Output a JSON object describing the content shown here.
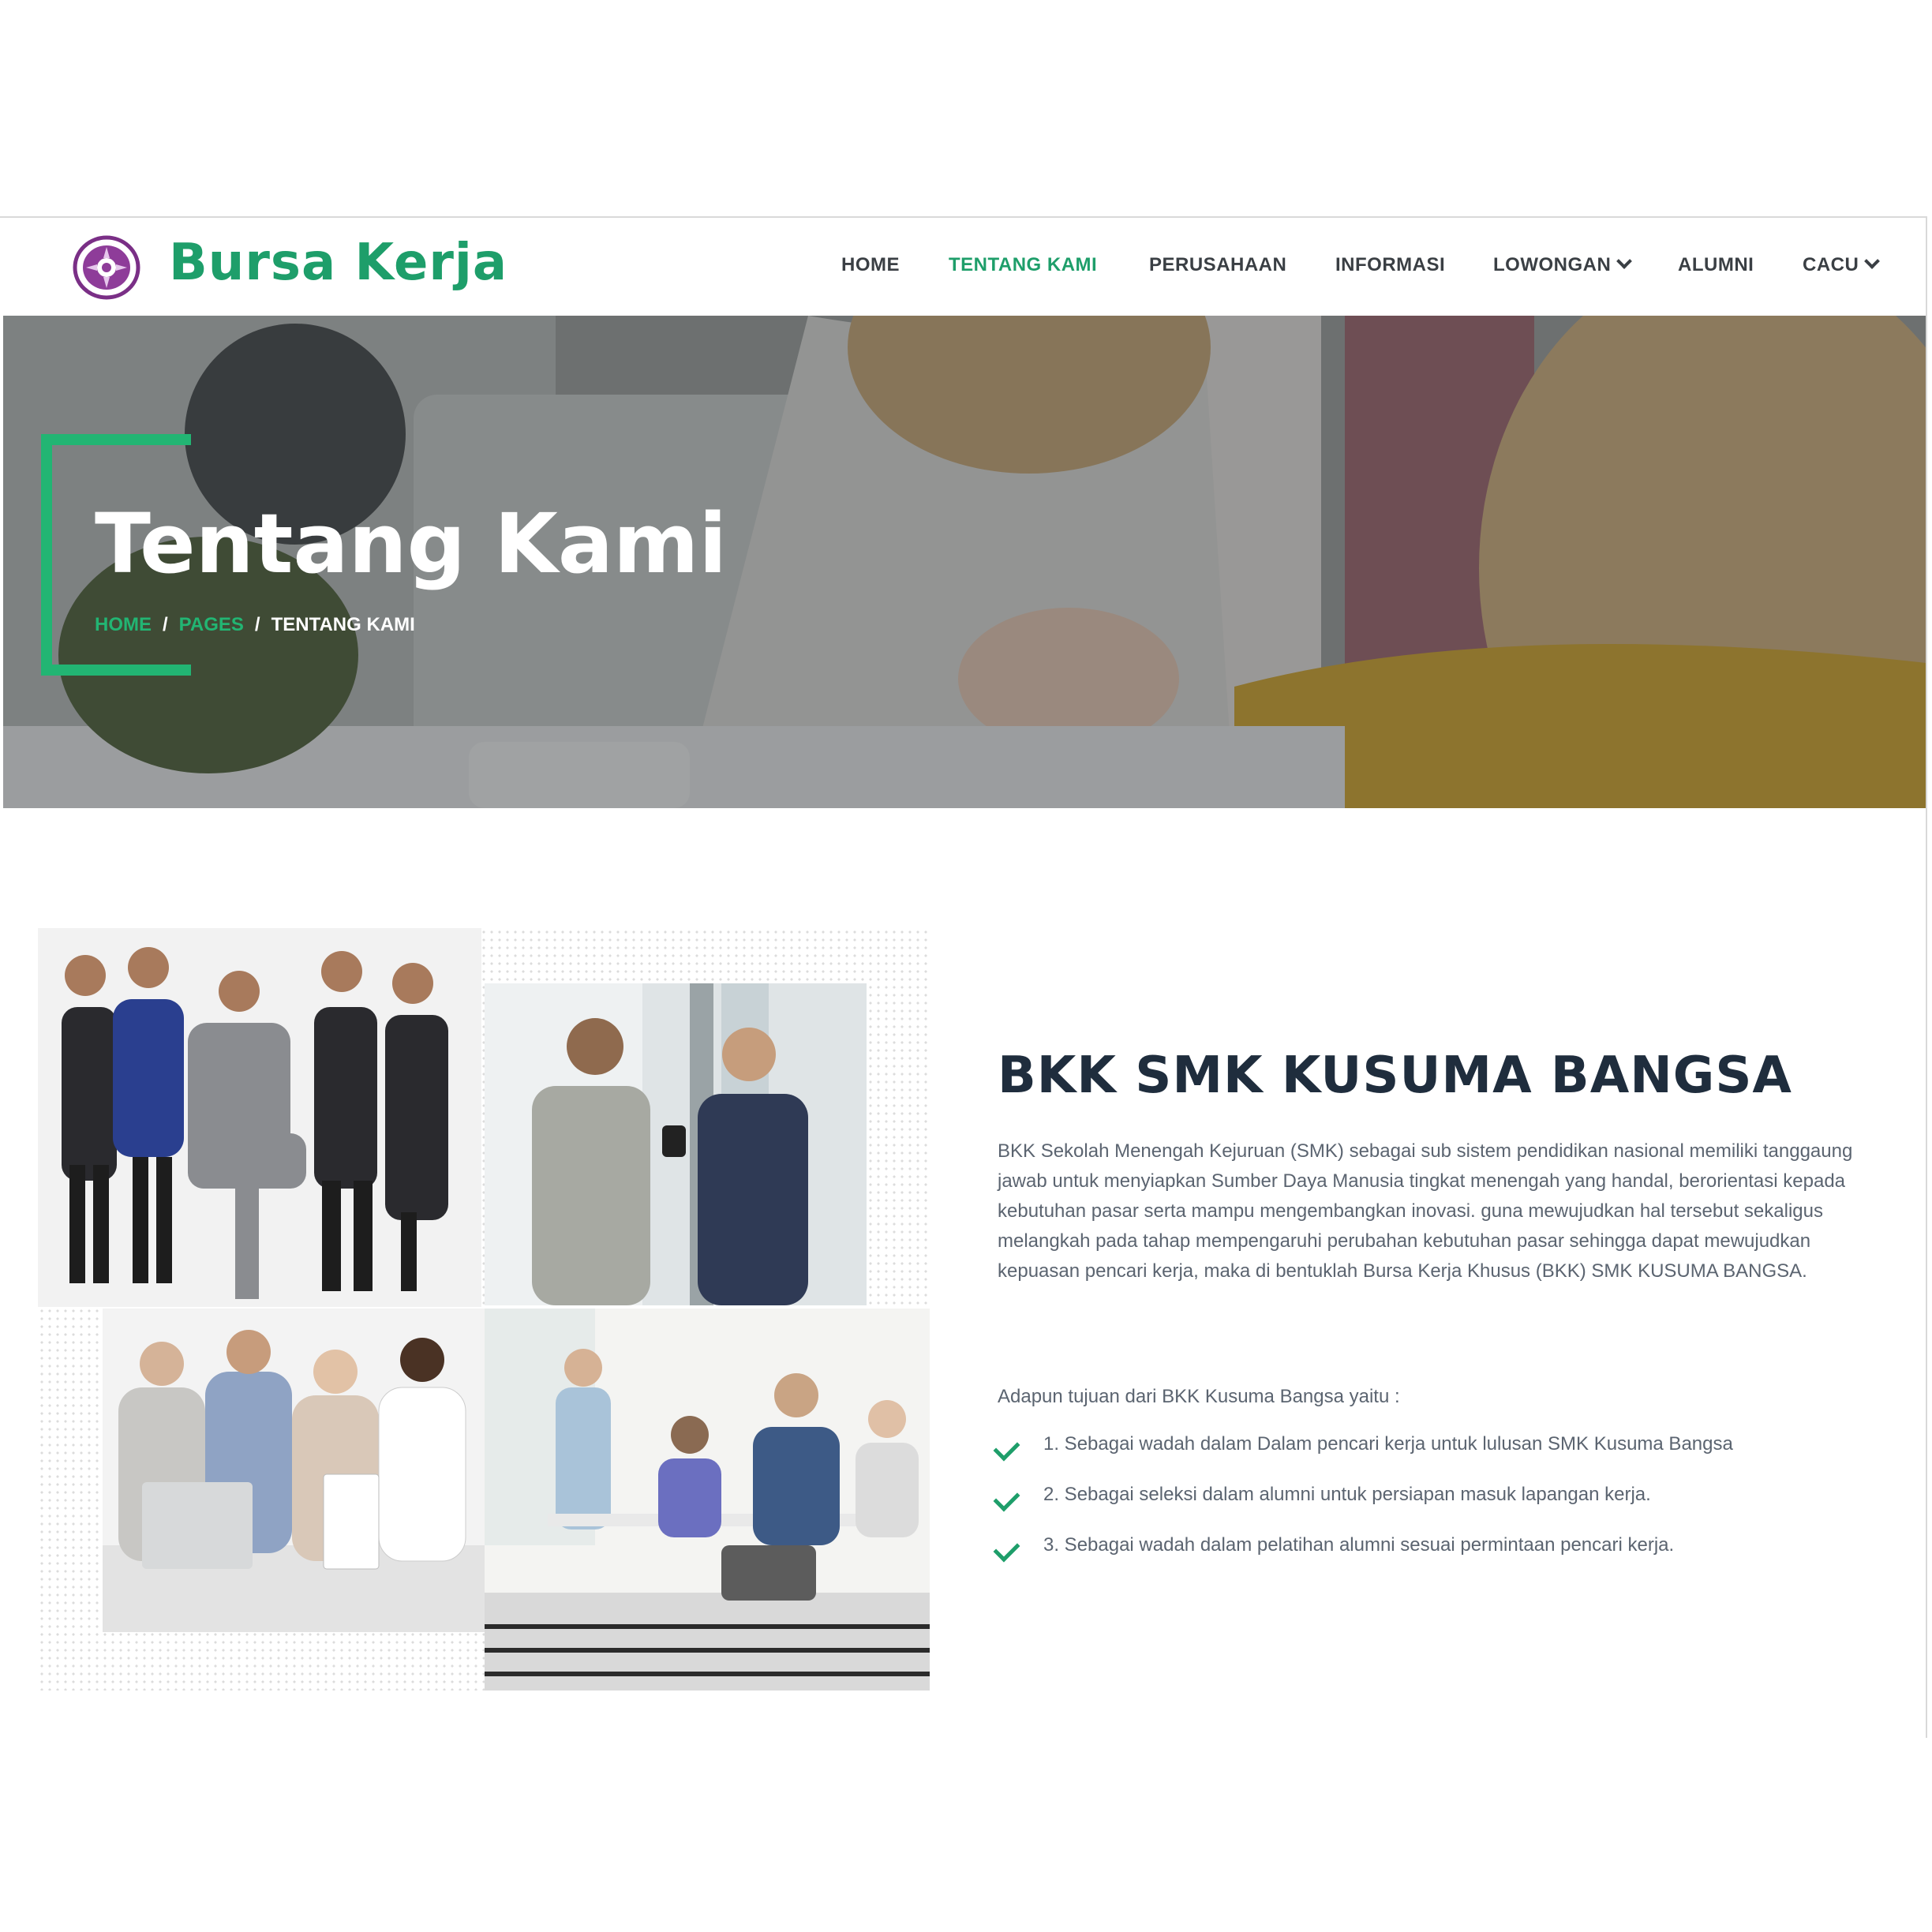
{
  "header": {
    "brand": "Bursa Kerja",
    "logo_icon": "school-emblem-icon",
    "nav": [
      {
        "label": "HOME",
        "active": false,
        "dropdown": false
      },
      {
        "label": "TENTANG KAMI",
        "active": true,
        "dropdown": false
      },
      {
        "label": "PERUSAHAAN",
        "active": false,
        "dropdown": false
      },
      {
        "label": "INFORMASI",
        "active": false,
        "dropdown": false
      },
      {
        "label": "LOWONGAN",
        "active": false,
        "dropdown": true
      },
      {
        "label": "ALUMNI",
        "active": false,
        "dropdown": false
      },
      {
        "label": "CACU",
        "active": false,
        "dropdown": true
      }
    ]
  },
  "hero": {
    "title": "Tentang Kami",
    "breadcrumb": {
      "home": "HOME",
      "pages": "PAGES",
      "sep": "/",
      "current": "TENTANG KAMI"
    }
  },
  "about": {
    "title": "BKK SMK KUSUMA BANGSA",
    "description": "BKK Sekolah Menengah Kejuruan (SMK) sebagai sub sistem pendidikan nasional memiliki tanggaung jawab untuk menyiapkan Sumber Daya Manusia tingkat menengah yang handal, berorientasi kepada kebutuhan pasar serta mampu mengembangkan inovasi. guna mewujudkan hal tersebut sekaligus melangkah pada tahap mempengaruhi perubahan kebutuhan pasar sehingga dapat mewujudkan kepuasan pencari kerja, maka di bentuklah Bursa Kerja Khusus (BKK) SMK KUSUMA BANGSA.",
    "goals_intro": "Adapun tujuan dari BKK Kusuma Bangsa yaitu :",
    "goals": [
      "1. Sebagai wadah dalam Dalam pencari kerja untuk lulusan SMK Kusuma Bangsa",
      "2. Sebagai seleksi dalam alumni untuk persiapan masuk lapangan kerja.",
      "3. Sebagai wadah dalam pelatihan alumni sesuai permintaan pencari kerja."
    ]
  },
  "colors": {
    "accent": "#1e9e6a",
    "bracket": "#22b573",
    "heading": "#1f2d3d",
    "body_text": "#5b6470",
    "nav_text": "#3a3f44"
  }
}
